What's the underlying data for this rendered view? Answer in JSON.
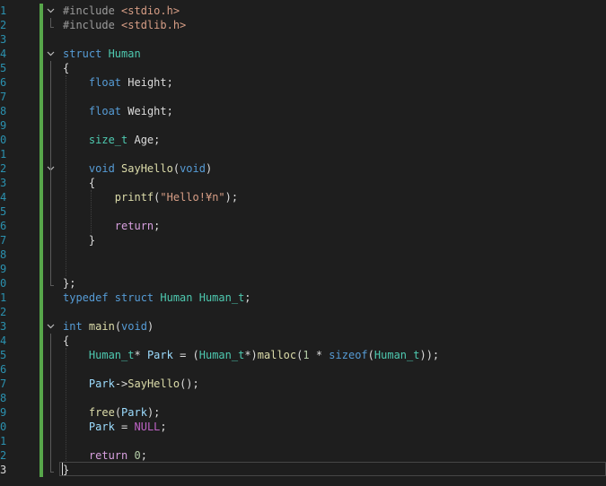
{
  "editor": {
    "line_numbers": [
      "1",
      "2",
      "3",
      "4",
      "5",
      "6",
      "7",
      "8",
      "9",
      "0",
      "1",
      "2",
      "3",
      "4",
      "5",
      "6",
      "7",
      "8",
      "9",
      "0",
      "1",
      "2",
      "3",
      "4",
      "5",
      "6",
      "7",
      "8",
      "9",
      "0",
      "1",
      "2",
      "3"
    ],
    "lines": [
      [
        {
          "c": "pp",
          "t": "#include "
        },
        {
          "c": "inc",
          "t": "<stdio.h>"
        }
      ],
      [
        {
          "c": "pp",
          "t": "#include "
        },
        {
          "c": "inc",
          "t": "<stdlib.h>"
        }
      ],
      [],
      [
        {
          "c": "kw",
          "t": "struct "
        },
        {
          "c": "type",
          "t": "Human"
        }
      ],
      [
        {
          "c": "plain",
          "t": "{"
        }
      ],
      [
        {
          "c": "plain",
          "t": "    "
        },
        {
          "c": "kw",
          "t": "float "
        },
        {
          "c": "plain",
          "t": "Height;"
        }
      ],
      [],
      [
        {
          "c": "plain",
          "t": "    "
        },
        {
          "c": "kw",
          "t": "float "
        },
        {
          "c": "plain",
          "t": "Weight;"
        }
      ],
      [],
      [
        {
          "c": "plain",
          "t": "    "
        },
        {
          "c": "type",
          "t": "size_t "
        },
        {
          "c": "plain",
          "t": "Age;"
        }
      ],
      [],
      [
        {
          "c": "plain",
          "t": "    "
        },
        {
          "c": "kw",
          "t": "void "
        },
        {
          "c": "fn",
          "t": "SayHello"
        },
        {
          "c": "plain",
          "t": "("
        },
        {
          "c": "kw",
          "t": "void"
        },
        {
          "c": "plain",
          "t": ")"
        }
      ],
      [
        {
          "c": "plain",
          "t": "    {"
        }
      ],
      [
        {
          "c": "plain",
          "t": "        "
        },
        {
          "c": "fn",
          "t": "printf"
        },
        {
          "c": "plain",
          "t": "("
        },
        {
          "c": "str",
          "t": "\"Hello!¥n\""
        },
        {
          "c": "plain",
          "t": ");"
        }
      ],
      [],
      [
        {
          "c": "plain",
          "t": "        "
        },
        {
          "c": "ctrl",
          "t": "return"
        },
        {
          "c": "plain",
          "t": ";"
        }
      ],
      [
        {
          "c": "plain",
          "t": "    }"
        }
      ],
      [],
      [],
      [
        {
          "c": "plain",
          "t": "};"
        }
      ],
      [
        {
          "c": "kw",
          "t": "typedef struct "
        },
        {
          "c": "type",
          "t": "Human Human_t"
        },
        {
          "c": "plain",
          "t": ";"
        }
      ],
      [],
      [
        {
          "c": "kw",
          "t": "int "
        },
        {
          "c": "fn",
          "t": "main"
        },
        {
          "c": "plain",
          "t": "("
        },
        {
          "c": "kw",
          "t": "void"
        },
        {
          "c": "plain",
          "t": ")"
        }
      ],
      [
        {
          "c": "plain",
          "t": "{"
        }
      ],
      [
        {
          "c": "plain",
          "t": "    "
        },
        {
          "c": "type",
          "t": "Human_t"
        },
        {
          "c": "plain",
          "t": "* "
        },
        {
          "c": "var",
          "t": "Park"
        },
        {
          "c": "plain",
          "t": " = ("
        },
        {
          "c": "type",
          "t": "Human_t"
        },
        {
          "c": "plain",
          "t": "*)"
        },
        {
          "c": "fn",
          "t": "malloc"
        },
        {
          "c": "plain",
          "t": "("
        },
        {
          "c": "num",
          "t": "1"
        },
        {
          "c": "plain",
          "t": " * "
        },
        {
          "c": "kw",
          "t": "sizeof"
        },
        {
          "c": "plain",
          "t": "("
        },
        {
          "c": "type",
          "t": "Human_t"
        },
        {
          "c": "plain",
          "t": "));"
        }
      ],
      [],
      [
        {
          "c": "plain",
          "t": "    "
        },
        {
          "c": "var",
          "t": "Park"
        },
        {
          "c": "plain",
          "t": "->"
        },
        {
          "c": "fn",
          "t": "SayHello"
        },
        {
          "c": "plain",
          "t": "();"
        }
      ],
      [],
      [
        {
          "c": "plain",
          "t": "    "
        },
        {
          "c": "fn",
          "t": "free"
        },
        {
          "c": "plain",
          "t": "("
        },
        {
          "c": "var",
          "t": "Park"
        },
        {
          "c": "plain",
          "t": ");"
        }
      ],
      [
        {
          "c": "plain",
          "t": "    "
        },
        {
          "c": "var",
          "t": "Park"
        },
        {
          "c": "plain",
          "t": " = "
        },
        {
          "c": "mac",
          "t": "NULL"
        },
        {
          "c": "plain",
          "t": ";"
        }
      ],
      [],
      [
        {
          "c": "plain",
          "t": "    "
        },
        {
          "c": "ctrl",
          "t": "return "
        },
        {
          "c": "num",
          "t": "0"
        },
        {
          "c": "plain",
          "t": ";"
        }
      ],
      [
        {
          "c": "plain",
          "t": "}"
        }
      ]
    ],
    "current_line_index": 32,
    "colors": {
      "background": "#1e1e1e",
      "line_number": "#2b91af",
      "change_bar": "#57a64a",
      "keyword": "#569cd6",
      "type": "#4ec9b0",
      "function": "#dcdcaa",
      "string": "#d69d85"
    },
    "fold_icon": "chevron-down-icon"
  }
}
